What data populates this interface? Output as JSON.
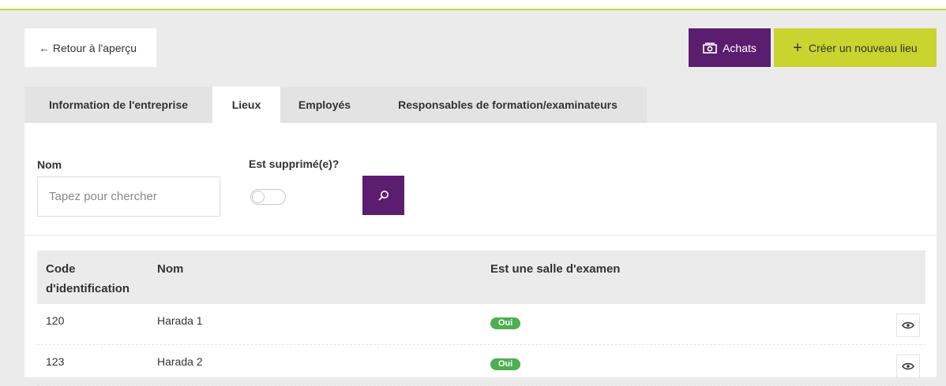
{
  "colors": {
    "accent_green": "#c9d42f",
    "brand_purple": "#5b1d6e",
    "badge_green": "#4caf50"
  },
  "header": {
    "back_label": "← Retour à l'aperçu",
    "achats_label": "Achats",
    "achats_icon": "money-icon",
    "create_icon": "plus-icon",
    "create_label": "Créer un nouveau lieu"
  },
  "tabs": [
    {
      "label": "Information de l'entreprise",
      "active": false
    },
    {
      "label": "Lieux",
      "active": true
    },
    {
      "label": "Employés",
      "active": false
    },
    {
      "label": "Responsables de formation/examinateurs",
      "active": false
    }
  ],
  "filters": {
    "name_label": "Nom",
    "name_placeholder": "Tapez pour chercher",
    "name_value": "",
    "deleted_label": "Est supprimé(e)?",
    "deleted_on": false,
    "search_icon": "search-icon"
  },
  "table": {
    "headers": {
      "code": "Code d'identification",
      "name": "Nom",
      "exam": "Est une salle d'examen"
    },
    "rows": [
      {
        "code": "120",
        "name": "Harada 1",
        "exam": "Oui",
        "action_icon": "eye-icon"
      },
      {
        "code": "123",
        "name": "Harada 2",
        "exam": "Oui",
        "action_icon": "eye-icon"
      }
    ]
  }
}
